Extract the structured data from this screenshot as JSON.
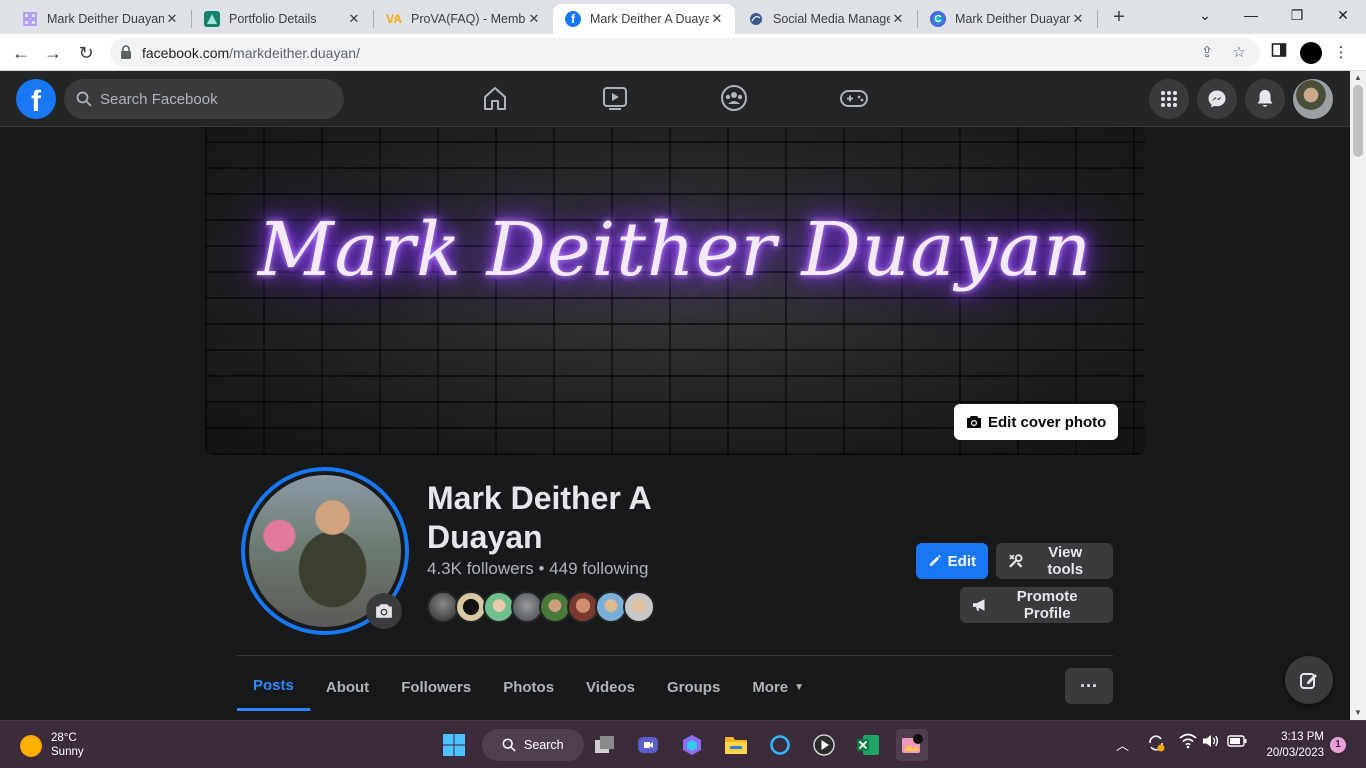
{
  "browser": {
    "tabs": [
      {
        "title": "Mark Deither Duayan",
        "favicon": "grid-icon",
        "color": "#a78bfa",
        "active": false
      },
      {
        "title": "Portfolio Details",
        "favicon": "portfolio-icon",
        "color": "#17806d",
        "active": false
      },
      {
        "title": "ProVA(FAQ) - Member",
        "favicon": "va-icon",
        "color": "#f5a800",
        "active": false
      },
      {
        "title": "Mark Deither A Duayan",
        "favicon": "facebook-icon",
        "color": "#1877f2",
        "active": true
      },
      {
        "title": "Social Media Manager",
        "favicon": "globe-icon",
        "color": "#5f6368",
        "active": false
      },
      {
        "title": "Mark Deither Duayan",
        "favicon": "canva-icon",
        "color": "#7d2ae8",
        "active": false
      }
    ],
    "url_host": "facebook.com",
    "url_path": "/markdeither.duayan/"
  },
  "facebook": {
    "search_placeholder": "Search Facebook",
    "cover_text": "Mark Deither Duayan",
    "edit_cover_label": "Edit cover photo",
    "profile_name": "Mark Deither A Duayan",
    "stats": "4.3K followers • 449 following",
    "edit_label": "Edit",
    "view_tools_label": "View tools",
    "promote_label": "Promote Profile",
    "tabs": [
      "Posts",
      "About",
      "Followers",
      "Photos",
      "Videos",
      "Groups",
      "More"
    ],
    "active_tab": "Posts",
    "more_dots": "···",
    "accent": "#1877f2"
  },
  "taskbar": {
    "temperature": "28°C",
    "weather": "Sunny",
    "search_label": "Search",
    "time": "3:13 PM",
    "date": "20/03/2023",
    "notification_count": "1"
  }
}
